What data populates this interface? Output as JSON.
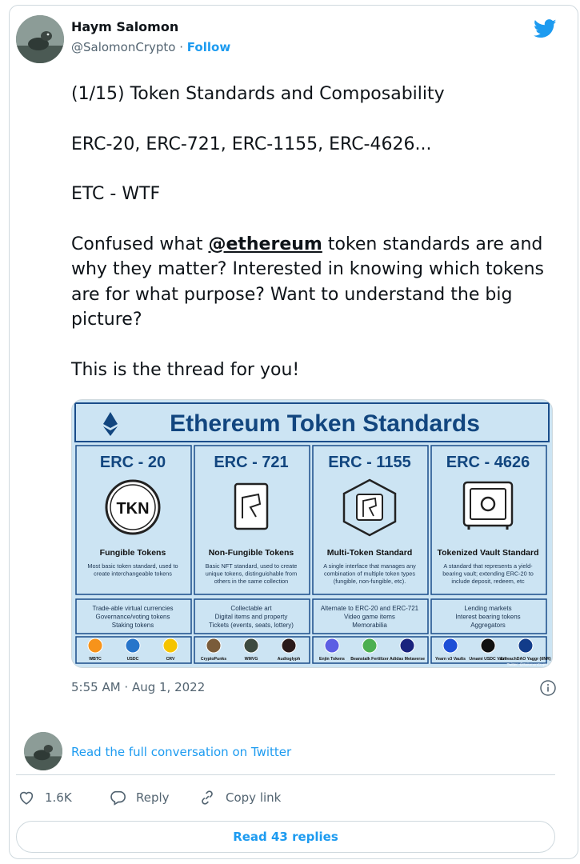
{
  "author": {
    "name": "Haym Salomon",
    "handle": "@SalomonCrypto",
    "separator": "·",
    "follow_label": "Follow"
  },
  "tweet": {
    "line1": "(1/15) Token Standards and Composability",
    "line2": "ERC-20, ERC-721, ERC-1155, ERC-4626...",
    "line3": "ETC - WTF",
    "line4_before": "Confused what ",
    "line4_mention": "@ethereum",
    "line4_after": " token standards are and why they matter? Interested in knowing which tokens are for what purpose? Want to understand the big picture?",
    "line5": "This is the thread for you!"
  },
  "infographic": {
    "title": "Ethereum Token Standards",
    "columns": [
      {
        "header": "ERC - 20",
        "icon_text": "TKN",
        "name": "Fungible Tokens",
        "desc": [
          "Most basic token standard, used to",
          "create interchangeable tokens"
        ],
        "uses": [
          "Trade-able virtual currencies",
          "Governance/voting tokens",
          "Staking tokens"
        ],
        "examples": [
          "WBTC",
          "USDC",
          "CRV"
        ]
      },
      {
        "header": "ERC - 721",
        "icon_text": "",
        "name": "Non-Fungible Tokens",
        "desc": [
          "Basic NFT standard, used to create",
          "unique tokens, distinguishable from",
          "others in the same collection"
        ],
        "uses": [
          "Collectable art",
          "Digital items and property",
          "Tickets (events, seats, lottery)"
        ],
        "examples": [
          "CryptoPunks",
          "WMVG",
          "Audioglyph"
        ]
      },
      {
        "header": "ERC - 1155",
        "icon_text": "",
        "name": "Multi-Token Standard",
        "desc": [
          "A single interface that manages any",
          "combination of multiple token types",
          "(fungible, non-fungible, etc)."
        ],
        "uses": [
          "Alternate to ERC-20 and ERC-721",
          "Video game items",
          "Memorabilia"
        ],
        "examples": [
          "Enjin Tokens",
          "Beanstalk Fertilizer",
          "Adidas Metaverse"
        ]
      },
      {
        "header": "ERC - 4626",
        "icon_text": "",
        "name": "Tokenized Vault Standard",
        "desc": [
          "A standard that represents a yield-",
          "bearing vault; extending ERC-20 to",
          "include deposit, redeem, etc"
        ],
        "uses": [
          "Lending markets",
          "Interest bearing tokens",
          "Aggregators"
        ],
        "examples": [
          "Yearn v3 Vaults",
          "Umami USDC Vault",
          "EnreachDAO Yaggr (tINR)"
        ]
      }
    ],
    "credit": "Twitter: @SalomonCrypto"
  },
  "timestamp": "5:55 AM · Aug 1, 2022",
  "read_full_label": "Read the full conversation on Twitter",
  "actions": {
    "like_count": "1.6K",
    "reply_label": "Reply",
    "copy_label": "Copy link"
  },
  "read_replies_label": "Read 43 replies",
  "colors": {
    "accent": "#1d9bf0",
    "infographic_bg": "#cce4f3",
    "infographic_border": "#1a4d8a",
    "infographic_text": "#12467f"
  },
  "icons": [
    "twitter-bird-icon",
    "info-icon",
    "heart-icon",
    "reply-icon",
    "link-icon"
  ]
}
